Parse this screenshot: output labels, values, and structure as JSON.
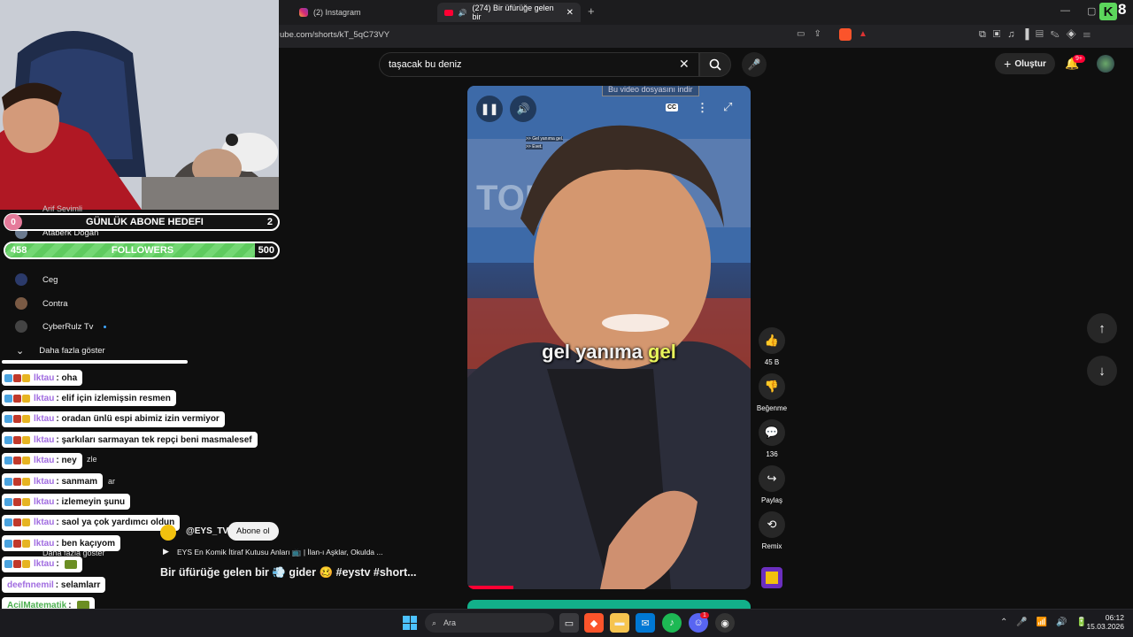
{
  "browser": {
    "tabs": [
      {
        "label": "(2) Instagram"
      },
      {
        "label": "(274) Bir üfürüğe gelen bir"
      }
    ],
    "new_tab": "+",
    "url": "ube.com/shorts/kT_5qC73VY",
    "window_controls": [
      "—",
      "▢",
      "✕"
    ]
  },
  "overlay": {
    "subscriber_goal": {
      "current": "0",
      "label": "GÜNLÜK ABONE HEDEFI",
      "target": "2"
    },
    "followers": {
      "current": "458",
      "label": "FOLLOWERS",
      "target": "500",
      "progress": 0.916
    },
    "logo": "K8"
  },
  "sidebar": {
    "partial_top": "Arif Sevimli",
    "items": [
      {
        "label": "Ataberk Doğan"
      },
      {
        "label": "Ceg"
      },
      {
        "label": "Contra"
      },
      {
        "label": "CyberRulz Tv"
      }
    ],
    "show_more": "Daha fazla göster"
  },
  "chat": [
    {
      "user": "lktau",
      "text": ": oha"
    },
    {
      "user": "lktau",
      "text": ": elif için izlemişsin resmen"
    },
    {
      "user": "lktau",
      "text": ": oradan ünlü espi abimiz izin vermiyor"
    },
    {
      "user": "lktau",
      "text": ": şarkıları sarmayan tek repçi beni masmalesef"
    },
    {
      "user": "lktau",
      "text": ": ney"
    },
    {
      "user": "lktau",
      "text": ": sanmam"
    },
    {
      "user": "lktau",
      "text": ": izlemeyin şunu"
    },
    {
      "user": "lktau",
      "text": ": saol ya çok yardımcı oldun"
    },
    {
      "user": "lktau",
      "text": ": ben kaçıyom"
    },
    {
      "user": "lktau",
      "text": ":"
    },
    {
      "user": "deefnnemil",
      "text": ": selamlarr"
    },
    {
      "user": "AcilMatematik",
      "text": ":"
    },
    {
      "user": "AcilMatematik",
      "text": ":"
    }
  ],
  "chat_peek": {
    "a": "zle",
    "b": "ar",
    "c": "Daha fazla göster"
  },
  "youtube": {
    "search_value": "taşacak bu deniz",
    "create_label": "Oluştur",
    "notif_count": "9+",
    "download_hint": "Bu video dosyasını indir",
    "caption_word1": "gel yanıma",
    "caption_word2": "gel",
    "cc_label": "CC",
    "channel": "@EYS_TV",
    "subscribe_label": "Abone ol",
    "playlist_text": "EYS En Komik İtiraf Kutusu Anları 📺 | İlan-ı Aşklar, Okulda ...",
    "video_title": "Bir üfürüğe gelen bir 💨 gider 🥴 #eystv #short...",
    "actions": {
      "like_count": "45 B",
      "dislike_label": "Beğenme",
      "comment_count": "136",
      "share_label": "Paylaş",
      "remix_label": "Remix"
    },
    "tiny_subtitle_1": ">> Gel yanıma gel.",
    "tiny_subtitle_2": ">> Evet."
  },
  "taskbar": {
    "search_placeholder": "Ara",
    "time": "06:12",
    "date": "15.03.2026",
    "discord_badge": "1"
  },
  "colors": {
    "accent_green": "#5fcb5f",
    "goal_pink": "#e57a9a",
    "yt_red": "#ff0033",
    "chat_user_purple": "#a06be0",
    "chat_user_green": "#4caf50"
  }
}
